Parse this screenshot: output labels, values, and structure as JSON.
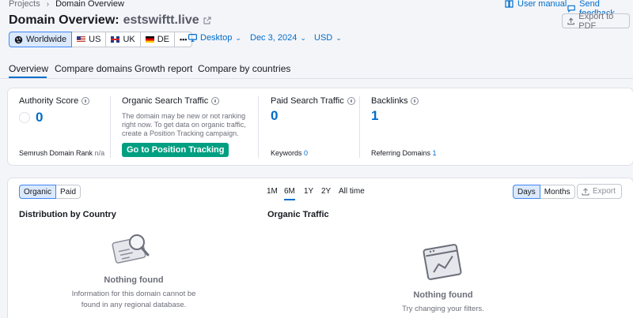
{
  "breadcrumb": {
    "root": "Projects",
    "current": "Domain Overview"
  },
  "header_links": {
    "manual": "User manual",
    "feedback": "Send feedback"
  },
  "export_pdf": "Export to PDF",
  "title": {
    "prefix": "Domain Overview:",
    "domain": "estswiftt.live"
  },
  "databases": {
    "worldwide": "Worldwide",
    "us": "US",
    "uk": "UK",
    "de": "DE",
    "more": "•••"
  },
  "filters": {
    "device": "Desktop",
    "date": "Dec 3, 2024",
    "currency": "USD"
  },
  "tabs": [
    "Overview",
    "Compare domains",
    "Growth report",
    "Compare by countries"
  ],
  "metrics": {
    "authority": {
      "title": "Authority Score",
      "value": "0",
      "rank_label": "Semrush Domain Rank",
      "rank_value": "n/a"
    },
    "organic": {
      "title": "Organic Search Traffic",
      "note": "The domain may be new or not ranking right now. To get data on organic traffic, create a Position Tracking campaign.",
      "button": "Go to Position Tracking"
    },
    "paid": {
      "title": "Paid Search Traffic",
      "value": "0",
      "keywords_label": "Keywords",
      "keywords_value": "0"
    },
    "backlinks": {
      "title": "Backlinks",
      "value": "1",
      "ref_label": "Referring Domains",
      "ref_value": "1"
    }
  },
  "traffic_toggle": {
    "organic": "Organic",
    "paid": "Paid"
  },
  "periods": [
    "1M",
    "6M",
    "1Y",
    "2Y",
    "All time"
  ],
  "granularity": {
    "days": "Days",
    "months": "Months"
  },
  "export": "Export",
  "distribution": {
    "title": "Distribution by Country",
    "empty_title": "Nothing found",
    "empty_line1": "Information for this domain cannot be",
    "empty_line2": "found in any regional database."
  },
  "organic_traffic": {
    "title": "Organic Traffic",
    "empty_title": "Nothing found",
    "empty_text": "Try changing your filters."
  },
  "colors": {
    "accent": "#006dca",
    "green": "#009f81"
  }
}
